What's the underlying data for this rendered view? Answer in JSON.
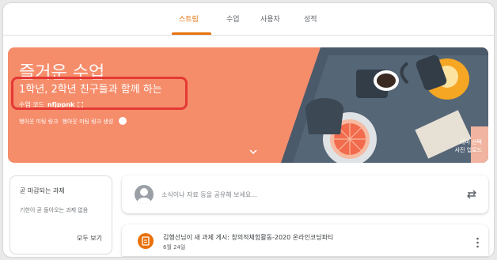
{
  "tabs": [
    {
      "label": "스트림",
      "active": true
    },
    {
      "label": "수업",
      "active": false
    },
    {
      "label": "사용자",
      "active": false
    },
    {
      "label": "성적",
      "active": false
    }
  ],
  "banner": {
    "title": "즐거운 수업",
    "subtitle": "1학년, 2학년 친구들과 함께 하는",
    "code_label": "수업 코드",
    "code_value": "nfjppnk",
    "meet_link_1": "행아웃 미팅 링크",
    "meet_link_2": "행아웃 미팅 링크 생성",
    "theme_select": "테마 선택",
    "upload_photo": "사진 업로드",
    "color": "#f58d6b"
  },
  "upcoming": {
    "title": "곧 마감되는 과제",
    "empty_text": "기한이 곧 돌아오는 과제 없음",
    "view_all": "모두 보기"
  },
  "share": {
    "placeholder": "소식이나 자료 등을 공유해 보세요..."
  },
  "post": {
    "title": "김행선님이 새 과제 게시: 창의적체험활동-2020 온라인코딩파티",
    "date": "6월 24일"
  },
  "colors": {
    "accent": "#e8710a",
    "highlight": "#e53935"
  }
}
